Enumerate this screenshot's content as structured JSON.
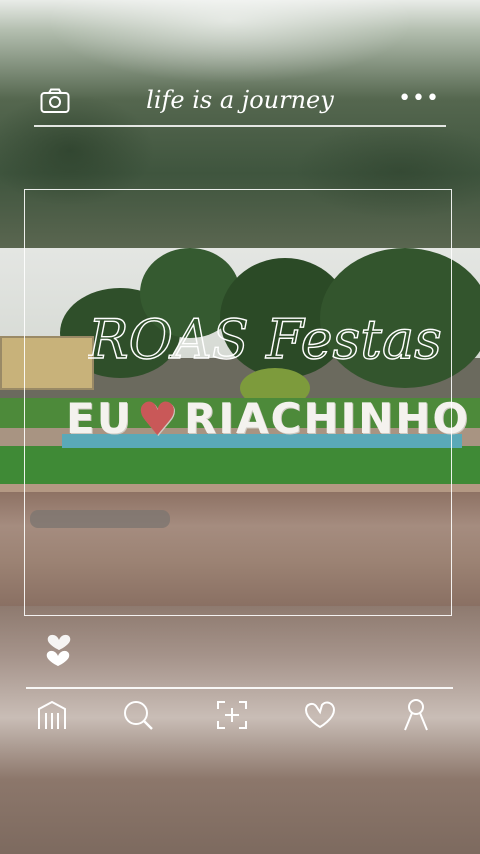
{
  "header": {
    "title": "life is a journey",
    "camera_icon": "camera-icon",
    "more_icon": "more-dots-icon",
    "more_label": "•••"
  },
  "photo": {
    "sign_left": "EU",
    "sign_heart": "♥",
    "sign_right": "RIACHINHO",
    "watermark_text": "ROAS Festas"
  },
  "like": {
    "icon": "heart-icon"
  },
  "nav": {
    "items": [
      {
        "name": "home",
        "icon": "home-icon"
      },
      {
        "name": "search",
        "icon": "search-icon"
      },
      {
        "name": "add",
        "icon": "add-icon"
      },
      {
        "name": "likes",
        "icon": "heart-icon"
      },
      {
        "name": "profile",
        "icon": "profile-icon"
      }
    ]
  },
  "colors": {
    "accent": "#ffffff",
    "sign_heart": "#c95858",
    "sign_base": "#5aa9b8"
  }
}
